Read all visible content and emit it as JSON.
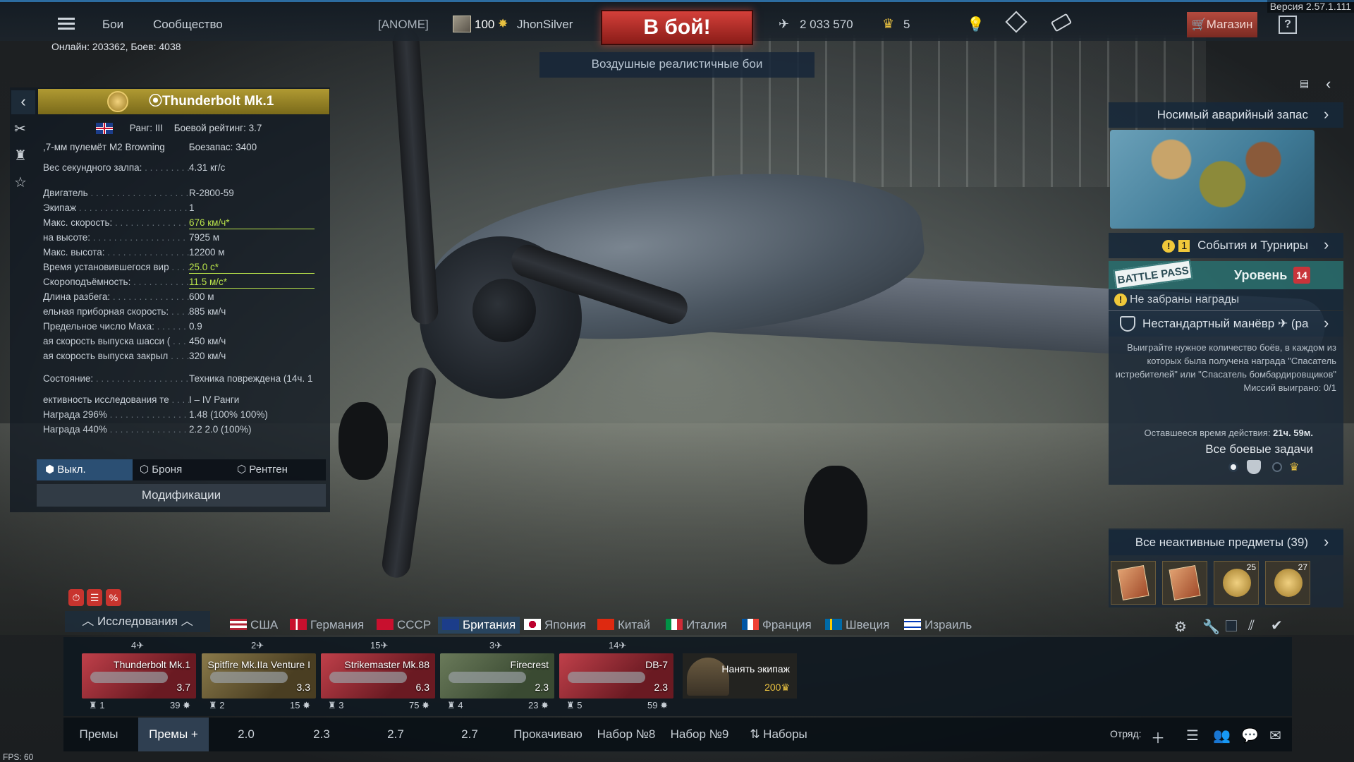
{
  "topbar": {
    "menu1": "Бои",
    "menu2": "Сообщество",
    "clan_tag": "[ANOME]",
    "player_level": "100",
    "player_name": "JhonSilver",
    "battle_button": "В бой!",
    "mode": "Воздушные реалистичные бои",
    "silver_lions": "2 033 570",
    "golden_eagles": "5",
    "shop": "Магазин",
    "help": "?",
    "version": "Версия 2.57.1.111",
    "online": "Онлайн: 203362, Боев: 4038"
  },
  "vehicle": {
    "name": "Thunderbolt Mk.1",
    "rank": "Ранг: III",
    "battle_rating": "Боевой рейтинг: 3.7",
    "weapon": ",7-мм пулемёт M2 Browning",
    "ammo": "Боезапас: 3400",
    "stats": [
      {
        "label": "Вес секундного залпа:",
        "value": "4.31 кг/с"
      },
      {
        "label": "Двигатель",
        "value": "R-2800-59"
      },
      {
        "label": "Экипаж",
        "value": "1"
      },
      {
        "label": "Макс. скорость:",
        "value": "676 км/ч*"
      },
      {
        "label": "на высоте:",
        "value": "7925 м"
      },
      {
        "label": "Макс. высота:",
        "value": "12200 м"
      },
      {
        "label": "Время установившегося вир",
        "value": "25.0 с*"
      },
      {
        "label": "Скороподъёмность:",
        "value": "11.5 м/с*"
      },
      {
        "label": "Длина разбега:",
        "value": "600 м"
      },
      {
        "label": "ельная приборная скорость:",
        "value": "885 км/ч"
      },
      {
        "label": "Предельное число Маха:",
        "value": "0.9"
      },
      {
        "label": "ая скорость выпуска шасси (",
        "value": "450 км/ч"
      },
      {
        "label": "ая скорость выпуска закрыл",
        "value": "320 км/ч"
      },
      {
        "label": "Состояние:",
        "value": "Техника повреждена (14ч. 1"
      },
      {
        "label": "ективность исследования те",
        "value": "I – IV Ранги"
      },
      {
        "label": "Награда 296%",
        "value": "1.48 (100%  100%)"
      },
      {
        "label": "Награда 440%",
        "value": "2.2  2.0  (100%)"
      }
    ],
    "mode_tabs": [
      "Выкл.",
      "Броня",
      "Рентген"
    ],
    "mods_button": "Модификации"
  },
  "right": {
    "supply_header": "Носимый аварийный запас",
    "events_count": "1",
    "events_header": "События и Турниры",
    "battle_pass_badge": "BATTLE PASS",
    "battle_pass_level": "Уровень",
    "battle_pass_level_num": "14",
    "battle_pass_warning": "Не забраны награды",
    "task_title": "Нестандартный манёвр ✈ (ра",
    "task_desc": "Выиграйте нужное количество боёв, в каждом из которых была получена награда \"Спасатель истребителей\" или \"Спасатель бомбардировщиков\"",
    "task_progress": "Миссий выиграно: 0/1",
    "task_time_label": "Оставшееся время действия:",
    "task_time_value": "21ч. 59м.",
    "task_all": "Все боевые задачи",
    "inactive_header": "Все неактивные предметы (39)",
    "inactive_counts": [
      "",
      "",
      "25",
      "27"
    ]
  },
  "research": {
    "tab": "Исследования",
    "nations": [
      "США",
      "Германия",
      "СССР",
      "Британия",
      "Япония",
      "Китай",
      "Италия",
      "Франция",
      "Швеция",
      "Израиль"
    ],
    "active_nation": "Британия"
  },
  "lineup": [
    {
      "name": "Thunderbolt Mk.1",
      "br": "3.7",
      "top": "4",
      "slot": "1",
      "spawn": "39"
    },
    {
      "name": "Spitfire Mk.IIa Venture I",
      "br": "3.3",
      "top": "2",
      "slot": "2",
      "spawn": "15"
    },
    {
      "name": "Strikemaster Mk.88",
      "br": "6.3",
      "top": "15",
      "slot": "3",
      "spawn": "75"
    },
    {
      "name": "Firecrest",
      "br": "2.3",
      "top": "3",
      "slot": "4",
      "spawn": "23"
    },
    {
      "name": "DB-7",
      "br": "2.3",
      "top": "14",
      "slot": "5",
      "spawn": "59"
    }
  ],
  "crew": {
    "label": "Нанять экипаж",
    "cost": "200"
  },
  "presets": [
    "Премы",
    "Премы +",
    "2.0",
    "2.3",
    "2.7",
    "2.7",
    "Прокачиваю",
    "Набор №8",
    "Набор №9",
    "Наборы"
  ],
  "squad_label": "Отряд:",
  "fps": "FPS: 60",
  "colors": {
    "accent": "#2c6ca0",
    "battle": "#d4403a",
    "highlight": "#b9e34a",
    "premium": "#b09a32"
  }
}
